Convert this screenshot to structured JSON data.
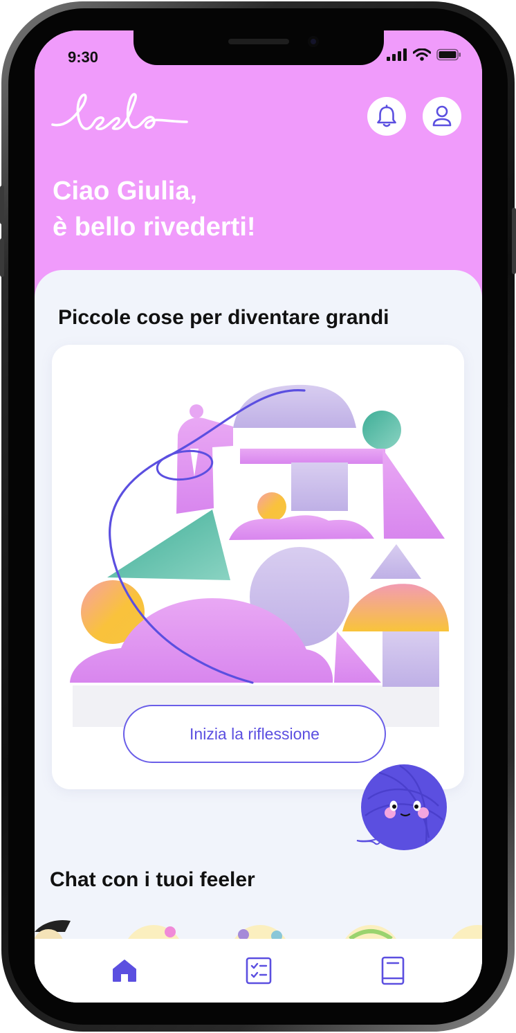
{
  "status_bar": {
    "time": "9:30"
  },
  "header": {
    "logo_text": "feelo",
    "greeting_line1": "Ciao Giulia,",
    "greeting_line2": "è bello rivederti!",
    "icons": [
      "bell-icon",
      "profile-icon"
    ]
  },
  "reflection_card": {
    "title": "Piccole cose per diventare grandi",
    "cta_label": "Inizia la riflessione"
  },
  "chat_section": {
    "title": "Chat con i tuoi feeler"
  },
  "bottom_nav": {
    "items": [
      {
        "icon": "home-icon",
        "active": true
      },
      {
        "icon": "checklist-icon",
        "active": false
      },
      {
        "icon": "book-icon",
        "active": false
      }
    ]
  },
  "colors": {
    "header_bg": "#f09bfb",
    "accent": "#5b4fe0",
    "sheet_bg": "#f1f4fb",
    "text_dark": "#111111"
  }
}
